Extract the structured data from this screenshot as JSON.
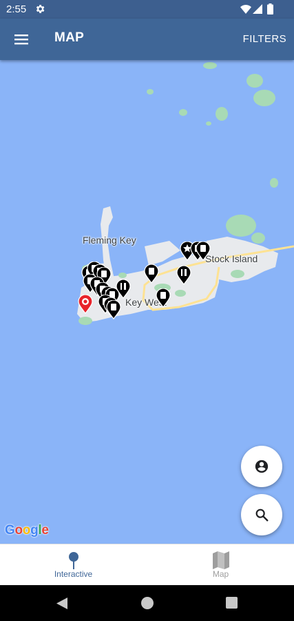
{
  "status_bar": {
    "time": "2:55",
    "icons": [
      "settings-icon",
      "wifi-icon",
      "signal-icon",
      "battery-icon"
    ]
  },
  "app_bar": {
    "menu_icon": "hamburger-menu-icon",
    "title": "MAP",
    "filters_label": "FILTERS"
  },
  "map": {
    "labels": {
      "fleming_key": "Fleming Key",
      "stock_island": "Stock Island",
      "key_west": "Key West"
    },
    "attribution": [
      "G",
      "o",
      "o",
      "g",
      "l",
      "e"
    ],
    "attribution_colors": [
      "#4285F4",
      "#EA4335",
      "#FBBC05",
      "#4285F4",
      "#34A853",
      "#EA4335"
    ],
    "colors": {
      "water": "#8ab4f8",
      "land": "#e8eaed",
      "park": "#a8dab5",
      "road": "#fde293",
      "pin": "#000000",
      "selected_pin": "#e8232b"
    },
    "pin_icons": [
      "info-pin-icon",
      "restaurant-pin-icon",
      "star-pin-icon",
      "location-pin-icon"
    ]
  },
  "fabs": {
    "account_icon": "account-circle-icon",
    "search_icon": "search-icon"
  },
  "bottom_nav": {
    "items": [
      {
        "label": "Interactive",
        "icon": "map-pin-icon",
        "active": true
      },
      {
        "label": "Map",
        "icon": "map-icon",
        "active": false
      }
    ],
    "active_color": "#3f6697",
    "inactive_color": "#9e9e9e"
  },
  "system_nav": {
    "icons": [
      "back-icon",
      "home-icon",
      "recents-icon"
    ]
  }
}
